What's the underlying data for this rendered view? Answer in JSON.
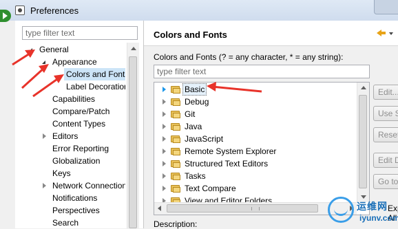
{
  "window": {
    "title": "Preferences"
  },
  "left": {
    "filter_placeholder": "type filter text",
    "tree": [
      {
        "label": "General",
        "state": "expanded"
      },
      {
        "label": "Appearance",
        "state": "expanded"
      },
      {
        "label": "Colors and Fonts",
        "state": "selected"
      },
      {
        "label": "Label Decorations",
        "state": "leaf"
      },
      {
        "label": "Capabilities",
        "state": "leaf"
      },
      {
        "label": "Compare/Patch",
        "state": "leaf"
      },
      {
        "label": "Content Types",
        "state": "leaf"
      },
      {
        "label": "Editors",
        "state": "collapsed"
      },
      {
        "label": "Error Reporting",
        "state": "leaf"
      },
      {
        "label": "Globalization",
        "state": "leaf"
      },
      {
        "label": "Keys",
        "state": "leaf"
      },
      {
        "label": "Network Connections",
        "state": "collapsed"
      },
      {
        "label": "Notifications",
        "state": "leaf"
      },
      {
        "label": "Perspectives",
        "state": "leaf"
      },
      {
        "label": "Search",
        "state": "leaf"
      }
    ]
  },
  "right": {
    "title": "Colors and Fonts",
    "filter_description": "Colors and Fonts (? = any character, * = any string):",
    "filter_placeholder": "type filter text",
    "categories": [
      "Basic",
      "Debug",
      "Git",
      "Java",
      "JavaScript",
      "Remote System Explorer",
      "Structured Text Editors",
      "Tasks",
      "Text Compare",
      "View and Editor Folders"
    ],
    "selected_category": "Basic",
    "buttons": [
      "Edit...",
      "Use System Font",
      "Reset",
      "Edit Default",
      "Go to Default"
    ],
    "expand_label": "Expand All",
    "description_label": "Description:"
  },
  "colors": {
    "annotation_arrow": "#e8332a",
    "selection": "#cce4f7",
    "watermark": "#1a6fb8"
  },
  "watermark": {
    "cn": "运维网",
    "en": "iyunv.com"
  }
}
